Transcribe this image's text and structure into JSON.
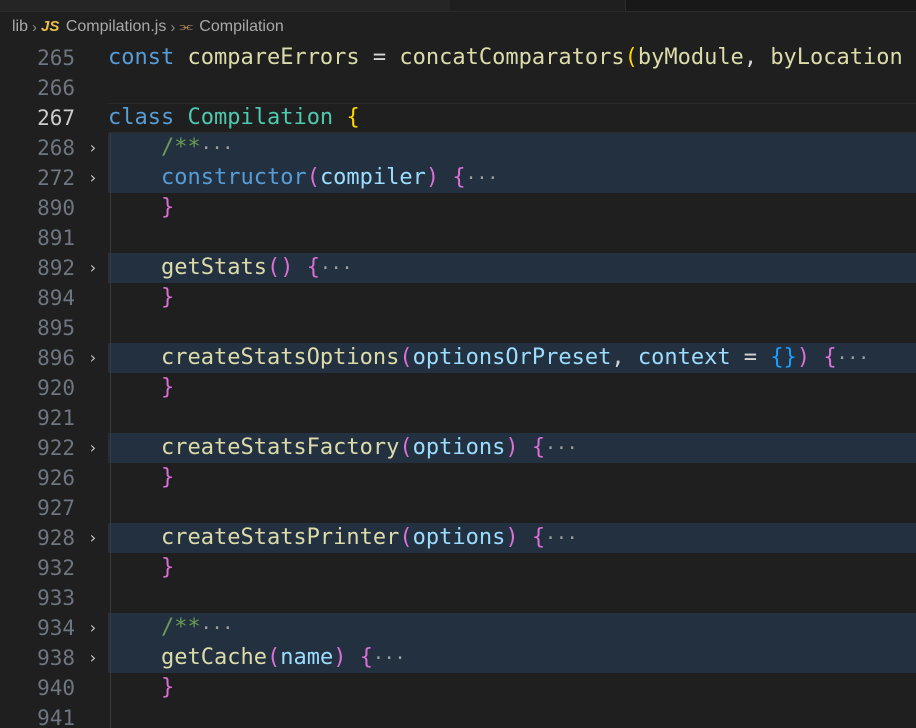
{
  "breadcrumb": {
    "folder": "lib",
    "file_icon": "JS",
    "file": "Compilation.js",
    "symbol": "Compilation"
  },
  "editor": {
    "current_line": "267",
    "lines": [
      {
        "num": "265",
        "fold": false,
        "tokens": [
          {
            "t": "const",
            "c": "kw"
          },
          {
            "t": " ",
            "c": "plain"
          },
          {
            "t": "compareErrors",
            "c": "fn"
          },
          {
            "t": " = ",
            "c": "plain"
          },
          {
            "t": "concatComparators",
            "c": "fn"
          },
          {
            "t": "(",
            "c": "b1"
          },
          {
            "t": "byModule",
            "c": "fn"
          },
          {
            "t": ", ",
            "c": "plain"
          },
          {
            "t": "byLocation",
            "c": "fn"
          }
        ]
      },
      {
        "num": "266",
        "fold": false,
        "tokens": []
      },
      {
        "num": "267",
        "fold": false,
        "tokens": [
          {
            "t": "class",
            "c": "kw"
          },
          {
            "t": " ",
            "c": "plain"
          },
          {
            "t": "Compilation",
            "c": "cls"
          },
          {
            "t": " ",
            "c": "plain"
          },
          {
            "t": "{",
            "c": "b1"
          }
        ]
      },
      {
        "num": "268",
        "fold": true,
        "tokens": [
          {
            "t": "    ",
            "c": "plain"
          },
          {
            "t": "/**",
            "c": "comment"
          },
          {
            "t": "···",
            "c": "ellipsis"
          }
        ]
      },
      {
        "num": "272",
        "fold": true,
        "tokens": [
          {
            "t": "    ",
            "c": "plain"
          },
          {
            "t": "constructor",
            "c": "kw"
          },
          {
            "t": "(",
            "c": "b2"
          },
          {
            "t": "compiler",
            "c": "param"
          },
          {
            "t": ")",
            "c": "b2"
          },
          {
            "t": " ",
            "c": "plain"
          },
          {
            "t": "{",
            "c": "b2"
          },
          {
            "t": "···",
            "c": "ellipsis"
          }
        ]
      },
      {
        "num": "890",
        "fold": false,
        "tokens": [
          {
            "t": "    ",
            "c": "plain"
          },
          {
            "t": "}",
            "c": "b2"
          }
        ]
      },
      {
        "num": "891",
        "fold": false,
        "tokens": []
      },
      {
        "num": "892",
        "fold": true,
        "tokens": [
          {
            "t": "    ",
            "c": "plain"
          },
          {
            "t": "getStats",
            "c": "fn"
          },
          {
            "t": "()",
            "c": "b2"
          },
          {
            "t": " ",
            "c": "plain"
          },
          {
            "t": "{",
            "c": "b2"
          },
          {
            "t": "···",
            "c": "ellipsis"
          }
        ]
      },
      {
        "num": "894",
        "fold": false,
        "tokens": [
          {
            "t": "    ",
            "c": "plain"
          },
          {
            "t": "}",
            "c": "b2"
          }
        ]
      },
      {
        "num": "895",
        "fold": false,
        "tokens": []
      },
      {
        "num": "896",
        "fold": true,
        "tokens": [
          {
            "t": "    ",
            "c": "plain"
          },
          {
            "t": "createStatsOptions",
            "c": "fn"
          },
          {
            "t": "(",
            "c": "b2"
          },
          {
            "t": "optionsOrPreset",
            "c": "param"
          },
          {
            "t": ", ",
            "c": "plain"
          },
          {
            "t": "context",
            "c": "param"
          },
          {
            "t": " = ",
            "c": "plain"
          },
          {
            "t": "{}",
            "c": "b3"
          },
          {
            "t": ")",
            "c": "b2"
          },
          {
            "t": " ",
            "c": "plain"
          },
          {
            "t": "{",
            "c": "b2"
          },
          {
            "t": "···",
            "c": "ellipsis"
          }
        ]
      },
      {
        "num": "920",
        "fold": false,
        "tokens": [
          {
            "t": "    ",
            "c": "plain"
          },
          {
            "t": "}",
            "c": "b2"
          }
        ]
      },
      {
        "num": "921",
        "fold": false,
        "tokens": []
      },
      {
        "num": "922",
        "fold": true,
        "tokens": [
          {
            "t": "    ",
            "c": "plain"
          },
          {
            "t": "createStatsFactory",
            "c": "fn"
          },
          {
            "t": "(",
            "c": "b2"
          },
          {
            "t": "options",
            "c": "param"
          },
          {
            "t": ")",
            "c": "b2"
          },
          {
            "t": " ",
            "c": "plain"
          },
          {
            "t": "{",
            "c": "b2"
          },
          {
            "t": "···",
            "c": "ellipsis"
          }
        ]
      },
      {
        "num": "926",
        "fold": false,
        "tokens": [
          {
            "t": "    ",
            "c": "plain"
          },
          {
            "t": "}",
            "c": "b2"
          }
        ]
      },
      {
        "num": "927",
        "fold": false,
        "tokens": []
      },
      {
        "num": "928",
        "fold": true,
        "tokens": [
          {
            "t": "    ",
            "c": "plain"
          },
          {
            "t": "createStatsPrinter",
            "c": "fn"
          },
          {
            "t": "(",
            "c": "b2"
          },
          {
            "t": "options",
            "c": "param"
          },
          {
            "t": ")",
            "c": "b2"
          },
          {
            "t": " ",
            "c": "plain"
          },
          {
            "t": "{",
            "c": "b2"
          },
          {
            "t": "···",
            "c": "ellipsis"
          }
        ]
      },
      {
        "num": "932",
        "fold": false,
        "tokens": [
          {
            "t": "    ",
            "c": "plain"
          },
          {
            "t": "}",
            "c": "b2"
          }
        ]
      },
      {
        "num": "933",
        "fold": false,
        "tokens": []
      },
      {
        "num": "934",
        "fold": true,
        "tokens": [
          {
            "t": "    ",
            "c": "plain"
          },
          {
            "t": "/**",
            "c": "comment"
          },
          {
            "t": "···",
            "c": "ellipsis"
          }
        ]
      },
      {
        "num": "938",
        "fold": true,
        "tokens": [
          {
            "t": "    ",
            "c": "plain"
          },
          {
            "t": "getCache",
            "c": "fn"
          },
          {
            "t": "(",
            "c": "b2"
          },
          {
            "t": "name",
            "c": "param"
          },
          {
            "t": ")",
            "c": "b2"
          },
          {
            "t": " ",
            "c": "plain"
          },
          {
            "t": "{",
            "c": "b2"
          },
          {
            "t": "···",
            "c": "ellipsis"
          }
        ]
      },
      {
        "num": "940",
        "fold": false,
        "tokens": [
          {
            "t": "    ",
            "c": "plain"
          },
          {
            "t": "}",
            "c": "b2"
          }
        ]
      },
      {
        "num": "941",
        "fold": false,
        "tokens": []
      }
    ]
  }
}
